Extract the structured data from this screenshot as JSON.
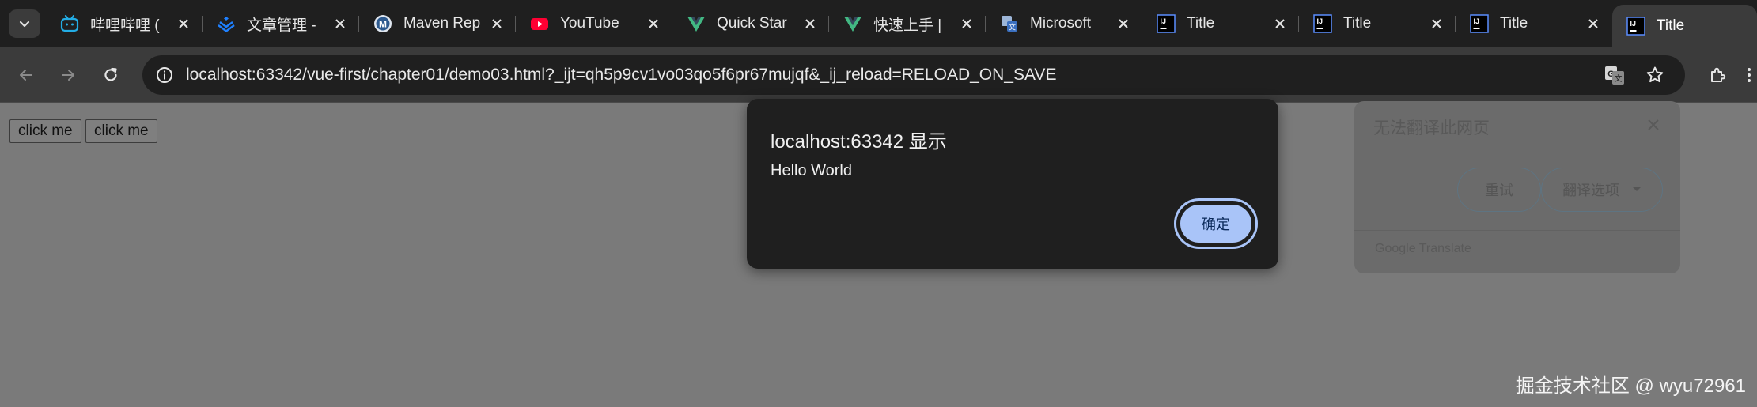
{
  "tabs": [
    {
      "title": "哔哩哔哩 (",
      "icon": "bilibili-icon"
    },
    {
      "title": "文章管理 -",
      "icon": "juejin-icon"
    },
    {
      "title": "Maven Rep",
      "icon": "maven-icon"
    },
    {
      "title": "YouTube",
      "icon": "youtube-icon"
    },
    {
      "title": "Quick Star",
      "icon": "vue-icon"
    },
    {
      "title": "快速上手 |",
      "icon": "vue-icon"
    },
    {
      "title": "Microsoft",
      "icon": "microsoft-translator-icon"
    },
    {
      "title": "Title",
      "icon": "intellij-icon"
    },
    {
      "title": "Title",
      "icon": "intellij-icon"
    },
    {
      "title": "Title",
      "icon": "intellij-icon"
    },
    {
      "title": "Title",
      "icon": "intellij-icon",
      "active": true
    }
  ],
  "address": {
    "url": "localhost:63342/vue-first/chapter01/demo03.html?_ijt=qh5p9cv1vo03qo5f6pr67mujqf&_ij_reload=RELOAD_ON_SAVE"
  },
  "page": {
    "buttons": [
      "click me",
      "click me"
    ]
  },
  "alert": {
    "title": "localhost:63342 显示",
    "message": "Hello World",
    "ok_label": "确定"
  },
  "translate_popup": {
    "title": "无法翻译此网页",
    "retry_label": "重试",
    "options_label": "翻译选项",
    "footer": "Google Translate"
  },
  "watermark": "掘金技术社区 @ wyu72961",
  "colors": {
    "tabstrip_bg": "#1f1f1f",
    "toolbar_bg": "#3b3b3b",
    "page_overlay": "#7a7a7a",
    "dialog_bg": "#1f1f1f",
    "ok_button": "#a9c4f8"
  }
}
